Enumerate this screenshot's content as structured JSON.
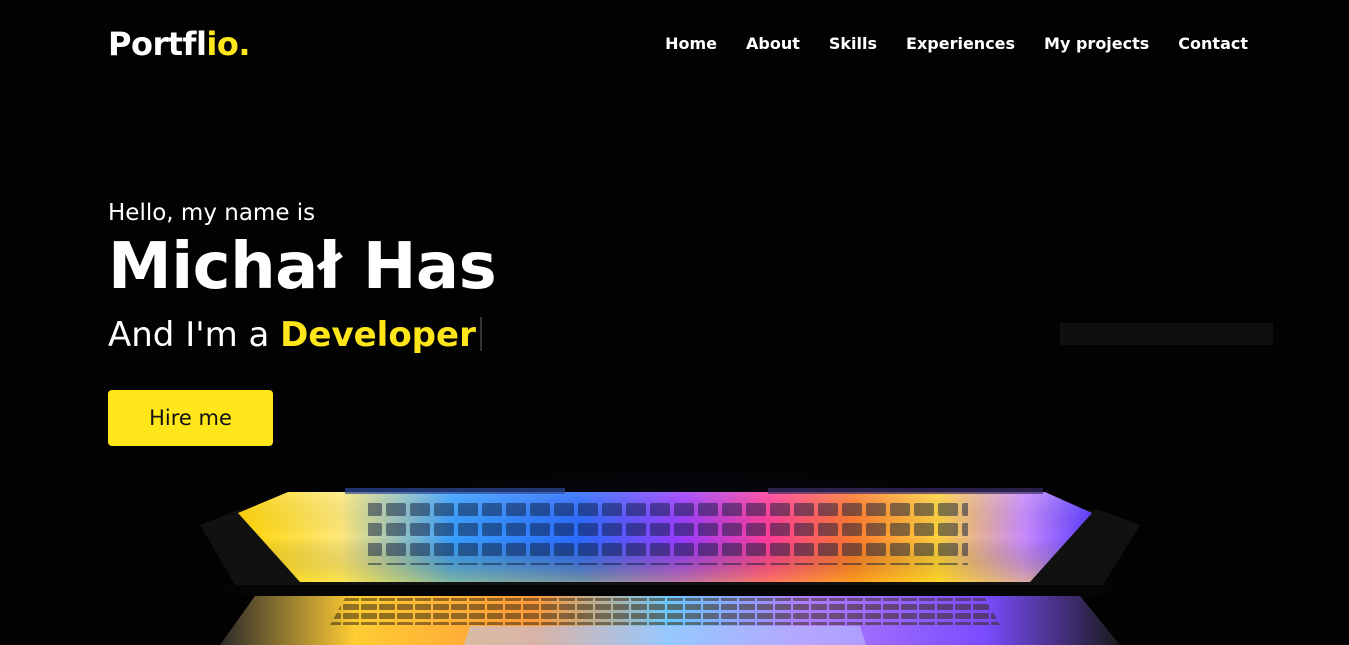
{
  "navbar": {
    "logo_main": "Portfl",
    "logo_accent": "io.",
    "items": [
      {
        "label": "Home"
      },
      {
        "label": "About"
      },
      {
        "label": "Skills"
      },
      {
        "label": "Experiences"
      },
      {
        "label": "My projects"
      },
      {
        "label": "Contact"
      }
    ]
  },
  "hero": {
    "greeting": "Hello, my name is",
    "name": "Michał Has",
    "role_prefix": "And I'm a ",
    "role": "Developer",
    "cta_label": "Hire me"
  },
  "colors": {
    "accent": "#ffe61b",
    "background": "#000000",
    "text": "#ffffff"
  }
}
